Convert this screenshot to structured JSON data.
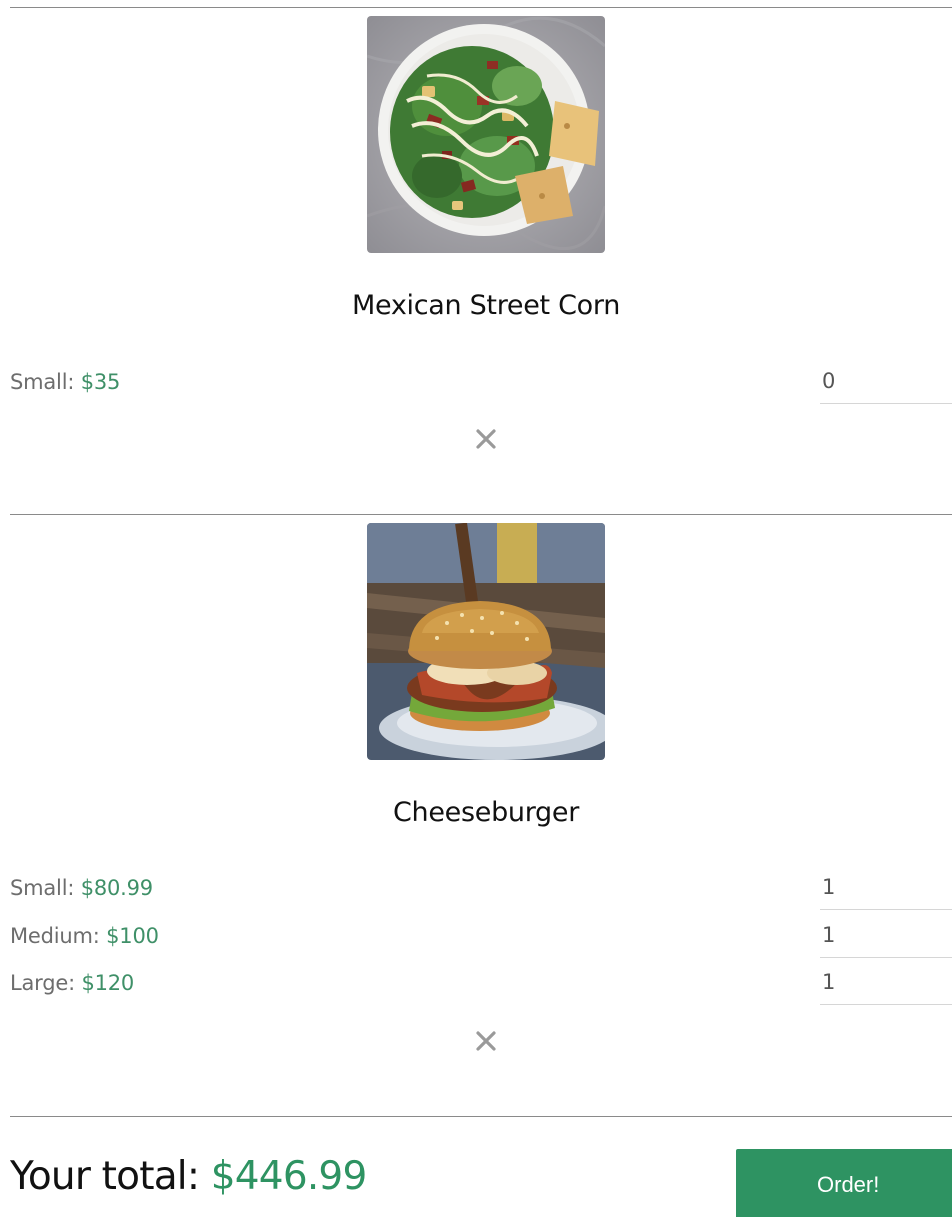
{
  "items": [
    {
      "name": "Mexican Street Corn",
      "image_icon": "salad-plate-photo",
      "sizes": [
        {
          "label": "Small: ",
          "price": "$35",
          "quantity": "0"
        }
      ],
      "remove_icon": "close-icon"
    },
    {
      "name": "Cheeseburger",
      "image_icon": "burger-photo",
      "sizes": [
        {
          "label": "Small: ",
          "price": "$80.99",
          "quantity": "1"
        },
        {
          "label": "Medium: ",
          "price": "$100",
          "quantity": "1"
        },
        {
          "label": "Large: ",
          "price": "$120",
          "quantity": "1"
        }
      ],
      "remove_icon": "close-icon"
    }
  ],
  "footer": {
    "total_label": "Your total: ",
    "total_amount": "$446.99",
    "order_label": "Order!"
  },
  "colors": {
    "accent": "#2e9362",
    "price": "#3f9068",
    "muted_text": "#6d6d6d",
    "divider": "#8a8a8a"
  }
}
